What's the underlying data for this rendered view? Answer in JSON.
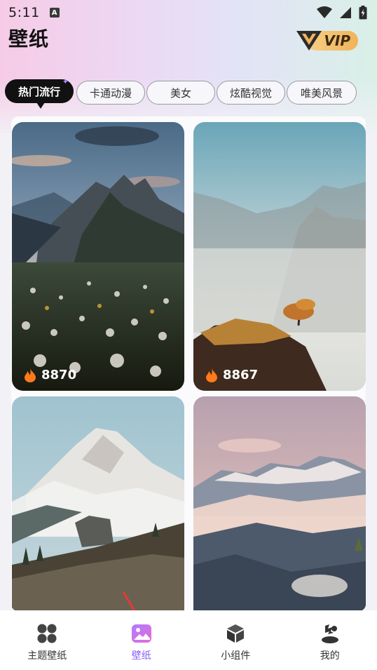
{
  "status_bar": {
    "time": "5:11",
    "notification_badge": "A"
  },
  "header": {
    "title": "壁纸",
    "vip_label": "VIP"
  },
  "tabs": [
    {
      "label": "热门流行",
      "active": true
    },
    {
      "label": "卡通动漫",
      "active": false
    },
    {
      "label": "美女",
      "active": false
    },
    {
      "label": "炫酷视觉",
      "active": false
    },
    {
      "label": "唯美风景",
      "active": false
    }
  ],
  "wallpapers": [
    {
      "count": "8870",
      "icon": "flame-icon"
    },
    {
      "count": "8867",
      "icon": "flame-icon"
    },
    {
      "count": "",
      "icon": ""
    },
    {
      "count": "",
      "icon": ""
    }
  ],
  "nav": [
    {
      "label": "主题壁纸",
      "icon": "grid-icon",
      "active": false
    },
    {
      "label": "壁纸",
      "icon": "image-icon",
      "active": true
    },
    {
      "label": "小组件",
      "icon": "cube-icon",
      "active": false
    },
    {
      "label": "我的",
      "icon": "profile-icon",
      "active": false
    }
  ],
  "colors": {
    "accent": "#8a5cf6",
    "vip_gold": "#f0b35a",
    "hot_flame": "#ff7a1a"
  }
}
